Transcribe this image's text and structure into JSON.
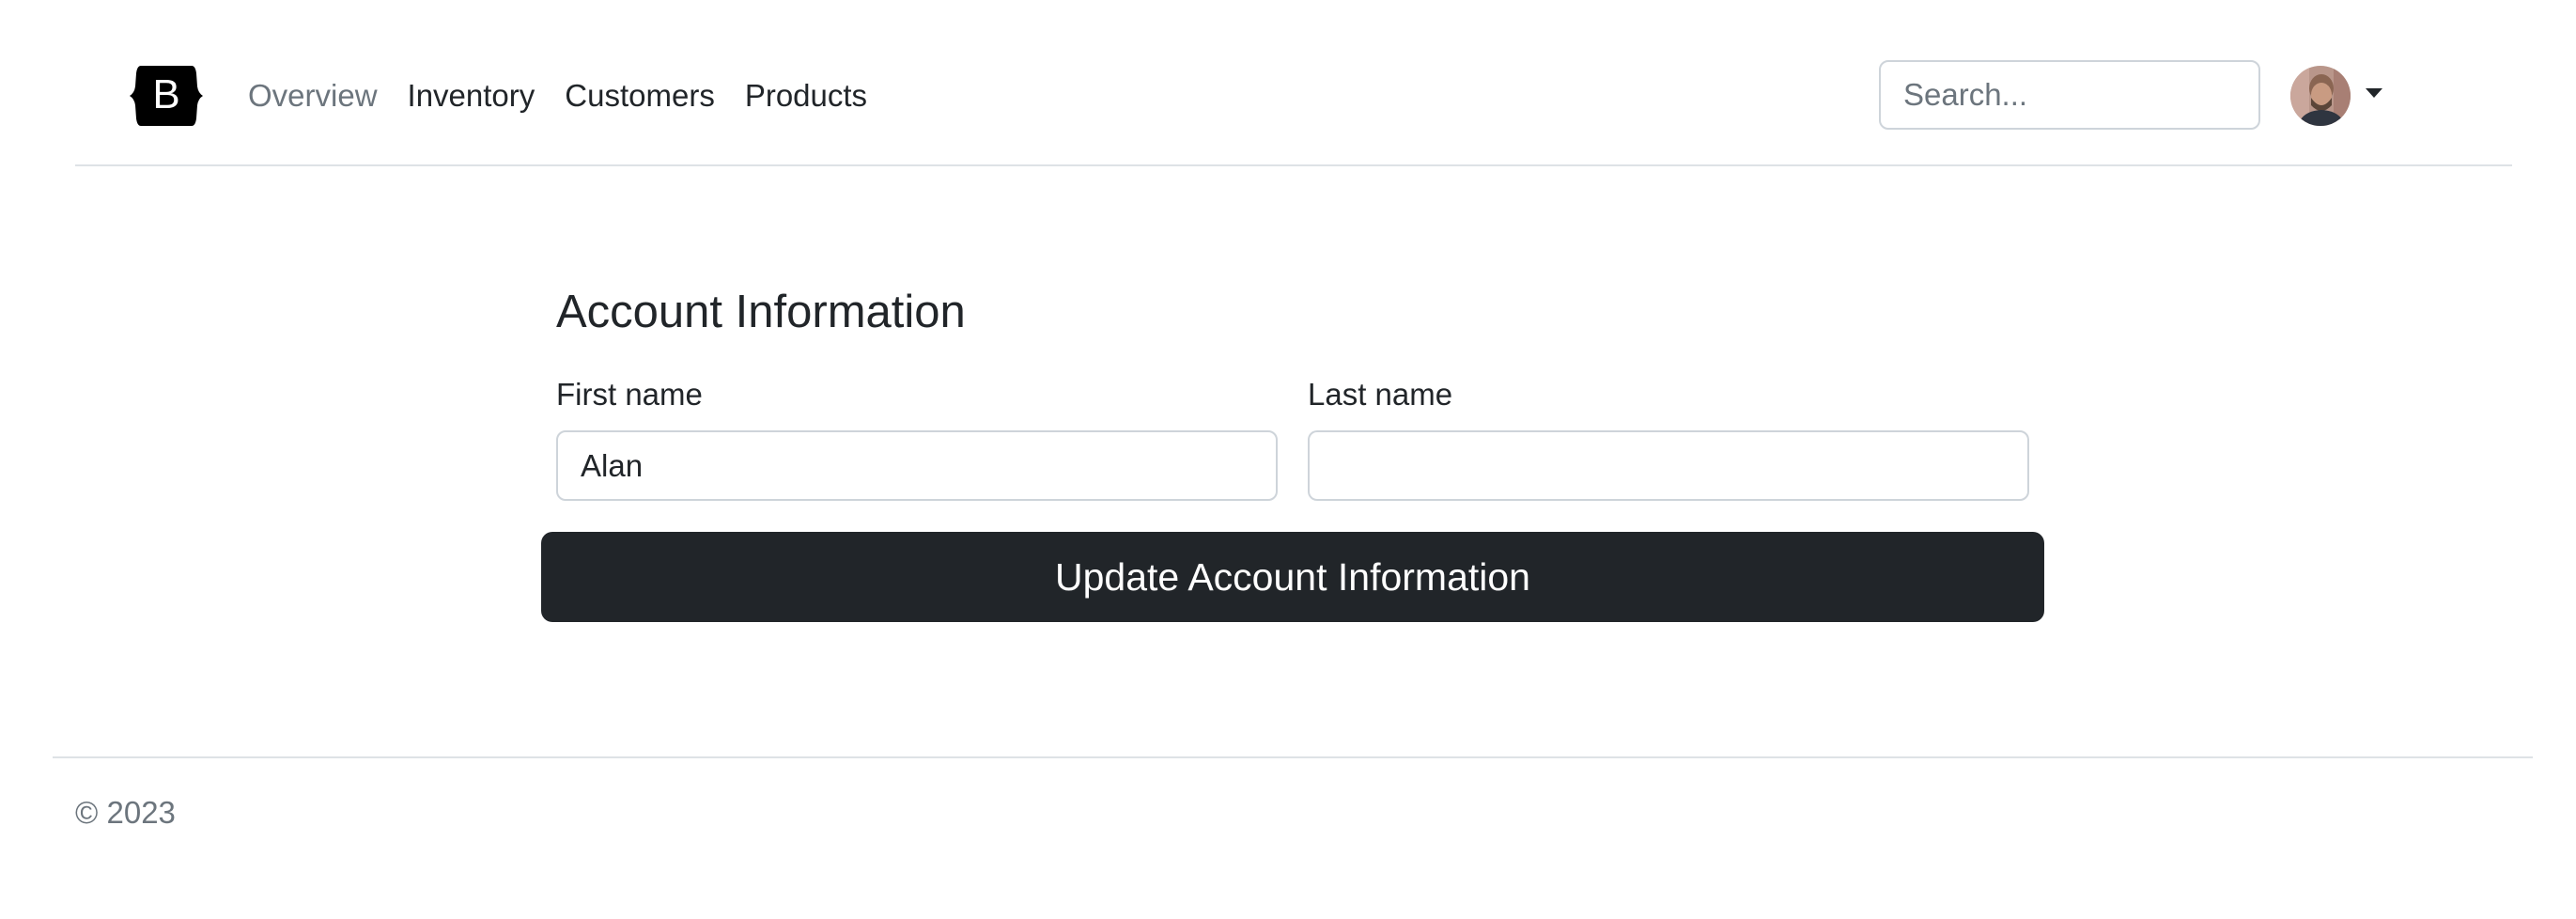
{
  "header": {
    "logo_letter": "B",
    "nav": [
      {
        "label": "Overview",
        "state": "muted"
      },
      {
        "label": "Inventory"
      },
      {
        "label": "Customers"
      },
      {
        "label": "Products"
      }
    ],
    "search": {
      "placeholder": "Search...",
      "value": ""
    },
    "user_menu": {
      "avatar": "avatar-photo",
      "icon": "caret-down-icon"
    }
  },
  "form": {
    "title": "Account Information",
    "first_name": {
      "label": "First name",
      "value": "Alan"
    },
    "last_name": {
      "label": "Last name",
      "value": ""
    },
    "submit_label": "Update Account Information"
  },
  "footer": {
    "text": "© 2023"
  },
  "colors": {
    "brand": "#000000",
    "primary_button": "#212529",
    "muted_text": "#6c757d",
    "border": "#dee2e6"
  }
}
